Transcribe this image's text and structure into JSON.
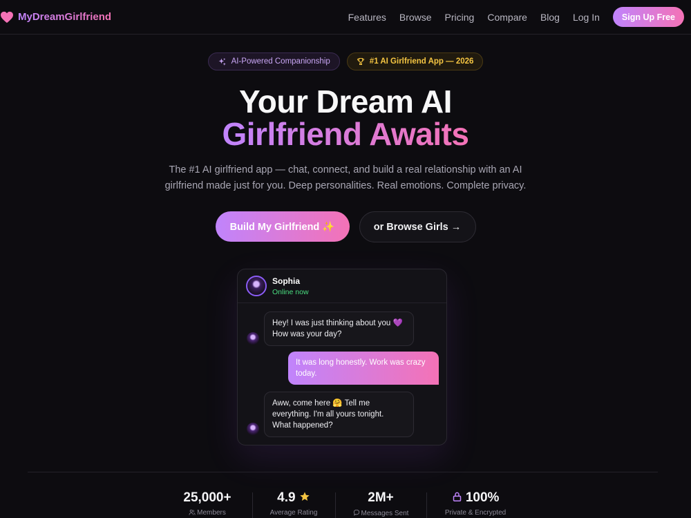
{
  "nav": {
    "brand": "MyDreamGirlfriend",
    "links": [
      "Features",
      "Browse",
      "Pricing",
      "Compare",
      "Blog",
      "Log In"
    ],
    "signup": "Sign Up Free"
  },
  "badges": {
    "ai": "AI-Powered Companionship",
    "top": "#1 AI Girlfriend App — 2026"
  },
  "hero": {
    "title_line1": "Your Dream AI",
    "title_line2": "Girlfriend Awaits",
    "subtitle_line1": "The #1 AI girlfriend app — chat, connect, and build a real relationship with an AI",
    "subtitle_line2": "girlfriend made just for you. Deep personalities. Real emotions. Complete privacy.",
    "cta_primary": "Build My Girlfriend ✨",
    "cta_secondary": "or Browse Girls →"
  },
  "chat": {
    "name": "Sophia",
    "status": "Online now",
    "messages": [
      {
        "from": "her",
        "lines": [
          "Hey! I was just thinking about you 💜",
          "How was your day?"
        ]
      },
      {
        "from": "me",
        "lines": [
          "It was long honestly. Work was crazy",
          "today."
        ]
      },
      {
        "from": "her",
        "lines": [
          "Aww, come here 🤗 Tell me",
          "everything. I'm all yours tonight.",
          "What happened?"
        ]
      }
    ]
  },
  "stats": [
    {
      "value": "25,000+",
      "label": "Members"
    },
    {
      "value": "4.9",
      "label": "Average Rating"
    },
    {
      "value": "2M+",
      "label": "Messages Sent"
    },
    {
      "value": "100%",
      "label": "Private & Encrypted"
    }
  ],
  "icons": {
    "brand": "heart-icon",
    "badge_ai": "sparkles-icon",
    "badge_top": "trophy-icon",
    "members": "users-icon",
    "rating": "star-icon",
    "messages": "chat-bubble-icon",
    "private": "lock-icon"
  },
  "colors": {
    "background": "#0d0c10",
    "accent_start": "#c084fc",
    "accent_end": "#f472b6",
    "online": "#4ade80",
    "gold": "#f5c542"
  }
}
